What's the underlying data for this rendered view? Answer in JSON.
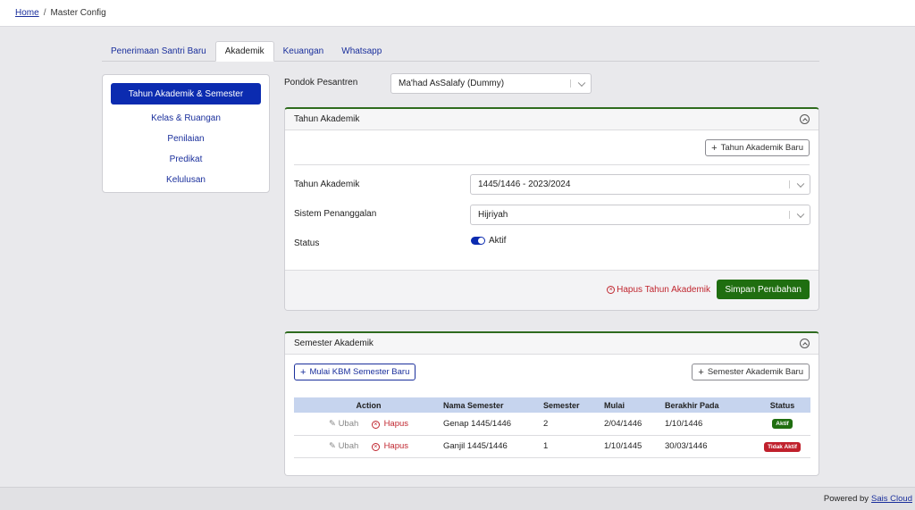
{
  "breadcrumb": {
    "home": "Home",
    "separator": "/",
    "current": "Master Config"
  },
  "tabs": [
    {
      "label": "Penerimaan Santri Baru",
      "active": false
    },
    {
      "label": "Akademik",
      "active": true
    },
    {
      "label": "Keuangan",
      "active": false
    },
    {
      "label": "Whatsapp",
      "active": false
    }
  ],
  "sidebar": {
    "items": [
      {
        "label": "Tahun Akademik & Semester",
        "active": true
      },
      {
        "label": "Kelas & Ruangan"
      },
      {
        "label": "Penilaian"
      },
      {
        "label": "Predikat"
      },
      {
        "label": "Kelulusan"
      }
    ]
  },
  "pondok": {
    "label": "Pondok Pesantren",
    "value": "Ma'had AsSalafy (Dummy)"
  },
  "tahun_card": {
    "title": "Tahun Akademik",
    "new_button": "Tahun Akademik Baru",
    "fields": {
      "tahun_label": "Tahun Akademik",
      "tahun_value": "1445/1446 - 2023/2024",
      "sistem_label": "Sistem Penanggalan",
      "sistem_value": "Hijriyah",
      "status_label": "Status",
      "status_value": "Aktif"
    },
    "delete_link": "Hapus Tahun Akademik",
    "save_button": "Simpan Perubahan"
  },
  "semester_card": {
    "title": "Semester Akademik",
    "start_button": "Mulai KBM Semester Baru",
    "new_button": "Semester Akademik Baru",
    "columns": [
      "Action",
      "Nama Semester",
      "Semester",
      "Mulai",
      "Berakhir Pada",
      "Status"
    ],
    "rows": [
      {
        "edit": "Ubah",
        "delete": "Hapus",
        "nama": "Genap 1445/1446",
        "semester": "2",
        "mulai": "2/04/1446",
        "berakhir": "1/10/1446",
        "status": "Aktif"
      },
      {
        "edit": "Ubah",
        "delete": "Hapus",
        "nama": "Ganjil 1445/1446",
        "semester": "1",
        "mulai": "1/10/1445",
        "berakhir": "30/03/1446",
        "status": "Tidak Aktif"
      }
    ]
  },
  "footer": {
    "text": "Powered by",
    "link": "Sais Cloud"
  },
  "colors": {
    "primary": "#0b2bb0",
    "success": "#1f6e10",
    "danger": "#c0202c",
    "table_header": "#c6d4ee"
  }
}
